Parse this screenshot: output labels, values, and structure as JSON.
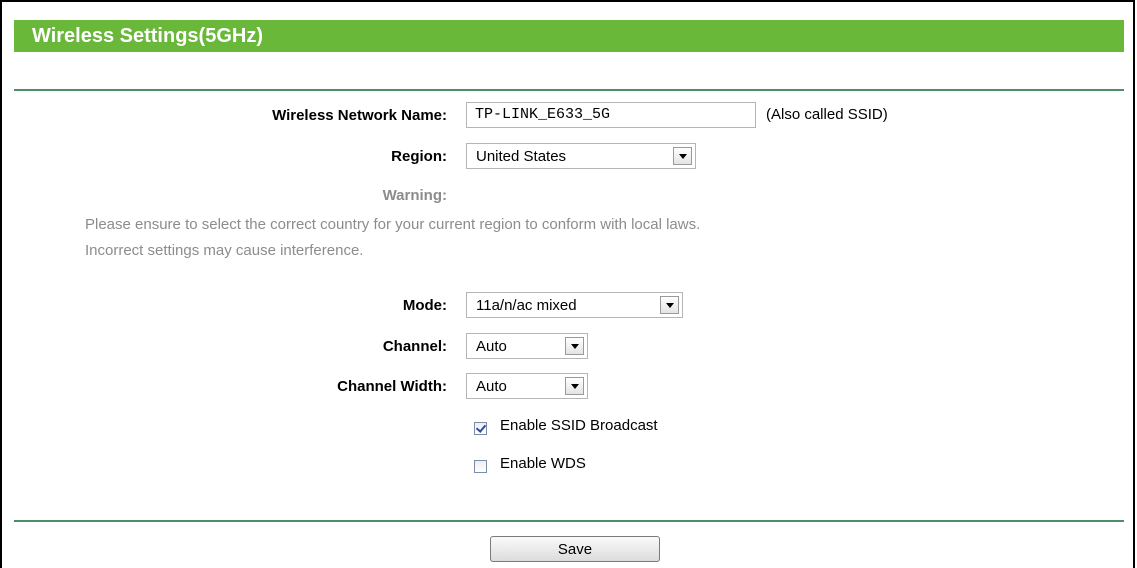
{
  "title": "Wireless Settings(5GHz)",
  "network_name": {
    "label": "Wireless Network Name:",
    "value": "TP-LINK_E633_5G",
    "hint": "(Also called SSID)"
  },
  "region": {
    "label": "Region:",
    "value": "United States"
  },
  "warning": {
    "label": "Warning:",
    "line1": "Please ensure to select the correct country for your current region to conform with local laws.",
    "line2": "Incorrect settings may cause interference."
  },
  "mode": {
    "label": "Mode:",
    "value": "11a/n/ac mixed"
  },
  "channel": {
    "label": "Channel:",
    "value": "Auto"
  },
  "channel_width": {
    "label": "Channel Width:",
    "value": "Auto"
  },
  "ssid_broadcast": {
    "label": "Enable SSID Broadcast",
    "checked": true
  },
  "wds": {
    "label": "Enable WDS",
    "checked": false
  },
  "save_label": "Save",
  "colors": {
    "title_bar": "#6ab83a",
    "rule": "#4c8f66",
    "muted_text": "#8c8c8c"
  }
}
